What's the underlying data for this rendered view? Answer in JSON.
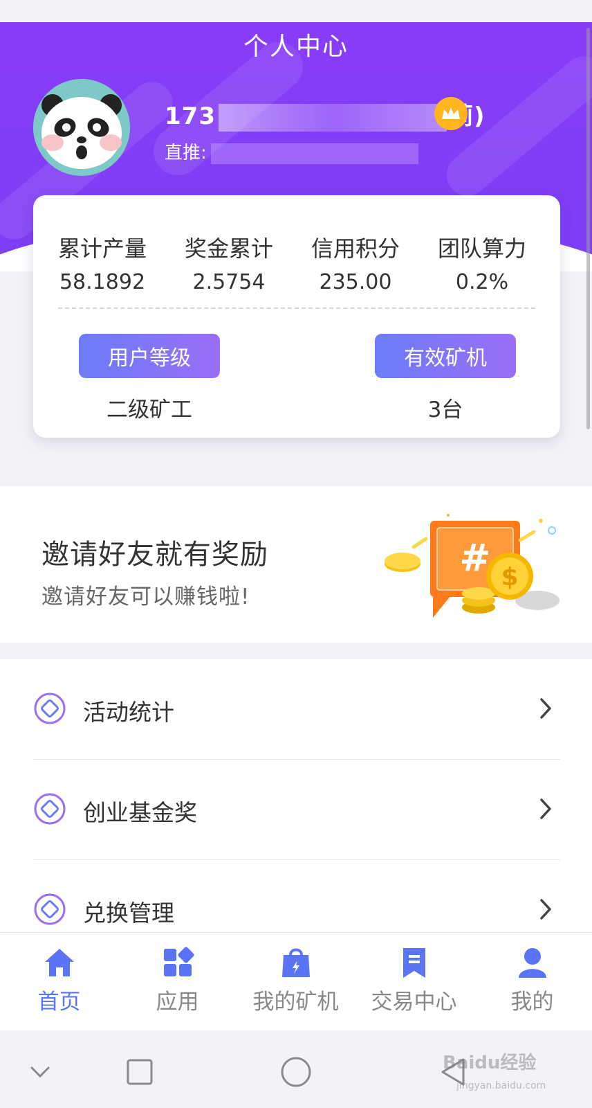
{
  "header": {
    "title": "个人中心",
    "username_visible_start": "173",
    "username_visible_end": "莉)",
    "referral_label": "直推:",
    "crown_icon": "crown-icon"
  },
  "stats": [
    {
      "label": "累计产量",
      "value": "58.1892"
    },
    {
      "label": "奖金累计",
      "value": "2.5754"
    },
    {
      "label": "信用积分",
      "value": "235.00"
    },
    {
      "label": "团队算力",
      "value": "0.2%"
    }
  ],
  "level": {
    "button_label": "用户等级",
    "value": "二级矿工"
  },
  "machines": {
    "button_label": "有效矿机",
    "value": "3台"
  },
  "invite": {
    "title": "邀请好友就有奖励",
    "subtitle": "邀请好友可以赚钱啦!",
    "art_symbol": "#",
    "coin_symbol": "$"
  },
  "menu": [
    {
      "label": "活动统计",
      "icon": "diamond-icon"
    },
    {
      "label": "创业基金奖",
      "icon": "diamond-icon"
    },
    {
      "label": "兑换管理",
      "icon": "diamond-icon"
    }
  ],
  "tabs": [
    {
      "label": "首页",
      "icon": "home-icon",
      "active": true
    },
    {
      "label": "应用",
      "icon": "apps-icon",
      "active": false
    },
    {
      "label": "我的矿机",
      "icon": "bag-icon",
      "active": false
    },
    {
      "label": "交易中心",
      "icon": "bookmark-icon",
      "active": false
    },
    {
      "label": "我的",
      "icon": "person-icon",
      "active": false
    }
  ],
  "watermark": {
    "text": "Baidu经验",
    "sub": "jingyan.baidu.com"
  },
  "colors": {
    "header_purple": "#8a3cf8",
    "pill_gradient_start": "#6c7cf7",
    "pill_gradient_end": "#9a6ef7",
    "tab_active": "#5b74f6",
    "crown_gold": "#ffb51e"
  }
}
